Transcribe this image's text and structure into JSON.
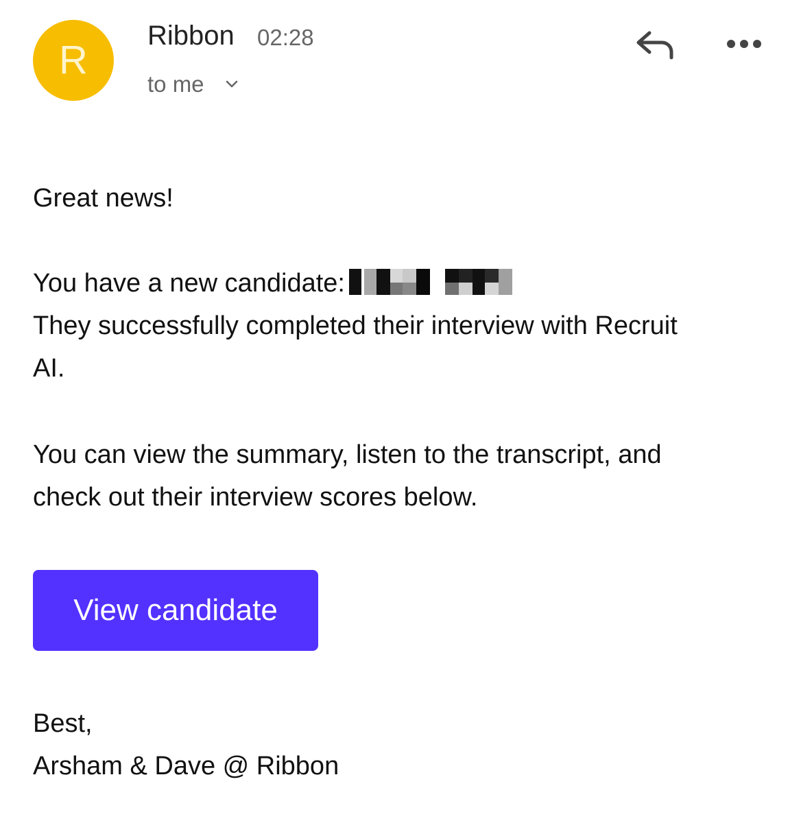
{
  "email": {
    "sender": {
      "avatar_letter": "R",
      "name": "Ribbon",
      "time": "02:28",
      "recipient": "to me"
    },
    "icons": {
      "reply": "reply-icon",
      "more": "more-options-icon",
      "expand": "chevron-down-icon"
    },
    "body": {
      "greeting": "Great news!",
      "candidate_prefix": "You have a new candidate:",
      "completed_line_1": "They successfully completed their interview with Recruit",
      "completed_line_2": "AI.",
      "view_line_1": "You can view the summary, listen to the transcript, and",
      "view_line_2": "check out their interview scores below.",
      "cta_label": "View candidate",
      "signoff": "Best,",
      "signature": "Arsham & Dave @ Ribbon"
    },
    "colors": {
      "avatar": "#f7bd00",
      "cta": "#5331ff"
    }
  }
}
